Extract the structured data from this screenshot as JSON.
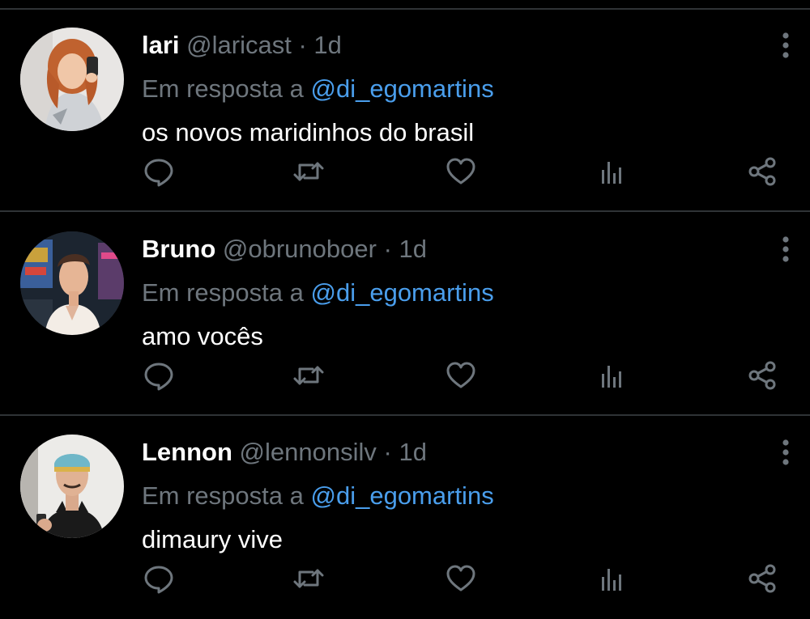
{
  "colors": {
    "background": "#000000",
    "divider": "#2f3336",
    "name": "#ffffff",
    "muted": "#6e767d",
    "mention": "#4a9eec",
    "body": "#ffffff"
  },
  "tweets": [
    {
      "name": "lari",
      "handle": "@laricast",
      "separator": "·",
      "time": "1d",
      "reply_prefix": "Em resposta a",
      "reply_mention": "@di_egomartins",
      "text": "os novos maridinhos do brasil",
      "avatar": "avatar-photo-redhead"
    },
    {
      "name": "Bruno",
      "handle": "@obrunoboer",
      "separator": "·",
      "time": "1d",
      "reply_prefix": "Em resposta a",
      "reply_mention": "@di_egomartins",
      "text": "amo vocês",
      "avatar": "avatar-photo-arcade"
    },
    {
      "name": "Lennon",
      "handle": "@lennonsilv",
      "separator": "·",
      "time": "1d",
      "reply_prefix": "Em resposta a",
      "reply_mention": "@di_egomartins",
      "text": "dimaury vive",
      "avatar": "avatar-photo-headband"
    }
  ],
  "icons": {
    "reply": "reply-icon",
    "retweet": "retweet-icon",
    "like": "heart-icon",
    "views": "views-icon",
    "share": "share-icon",
    "more": "more-vertical-icon"
  }
}
